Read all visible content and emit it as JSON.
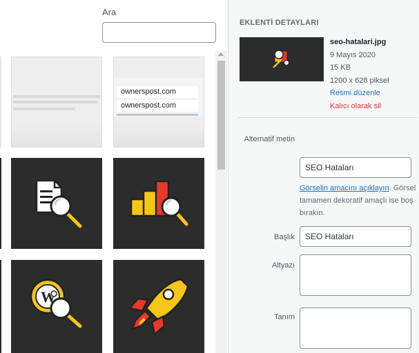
{
  "search": {
    "label": "Ara",
    "value": ""
  },
  "library": {
    "tiles": [
      {
        "name": "screenshot-search-results",
        "kind": "screenshot"
      },
      {
        "name": "screenshot-ownerspost",
        "kind": "screenshot",
        "text_lines": [
          "ownerspost.com",
          "ownerspost.com"
        ]
      },
      {
        "name": "seo-icon-document-search",
        "kind": "icon",
        "icon": "document-magnifier-icon"
      },
      {
        "name": "seo-icon-chart-search",
        "kind": "icon",
        "icon": "bar-chart-magnifier-icon"
      },
      {
        "name": "seo-icon-wordpress-search",
        "kind": "icon",
        "icon": "wordpress-magnifier-icon"
      },
      {
        "name": "seo-icon-rocket",
        "kind": "icon",
        "icon": "rocket-icon"
      }
    ]
  },
  "details": {
    "heading": "EKLENTİ DETAYLARI",
    "file_name": "seo-hatalari.jpg",
    "date": "9 Mayıs 2020",
    "size": "15 KB",
    "dimensions": "1200 x 628 piksel",
    "edit_link": "Resmi düzenle",
    "delete_link": "Kalıcı olarak sil",
    "fields": {
      "alt_label": "Alternatif metin",
      "alt_value": "SEO Hataları",
      "alt_help_link": "Görselin amacını açıklayın",
      "alt_help_text": ". Görsel tamamen dekoratif amaçlı ise boş bırakın.",
      "title_label": "Başlık",
      "title_value": "SEO Hataları",
      "caption_label": "Altyazı",
      "caption_value": "",
      "description_label": "Tanım",
      "description_value": ""
    }
  },
  "colors": {
    "tile_dark": "#2c2c2c",
    "accent_yellow": "#f5c518",
    "accent_red": "#e8392b",
    "link_blue": "#2271b1",
    "delete_red": "#d63638"
  }
}
